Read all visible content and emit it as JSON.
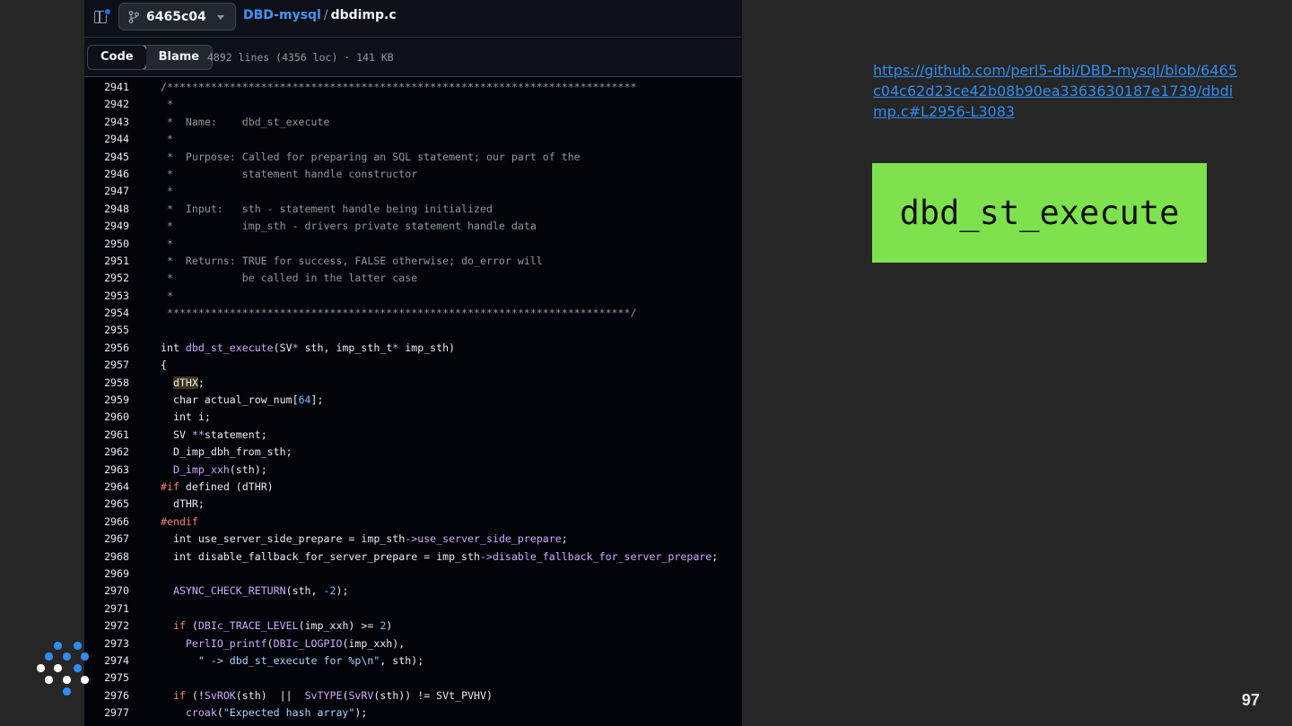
{
  "github": {
    "branch": "6465c04",
    "repo": "DBD-mysql",
    "separator": "/",
    "file": "dbdimp.c",
    "tabs": [
      "Code",
      "Blame"
    ],
    "file_meta": "4892 lines (4356 loc) · 141 KB"
  },
  "code_lines": [
    {
      "n": "2941",
      "t": "/***************************************************************************"
    },
    {
      "n": "2942",
      "t": " *"
    },
    {
      "n": "2943",
      "t": " *  Name:    dbd_st_execute"
    },
    {
      "n": "2944",
      "t": " *"
    },
    {
      "n": "2945",
      "t": " *  Purpose: Called for preparing an SQL statement; our part of the"
    },
    {
      "n": "2946",
      "t": " *           statement handle constructor"
    },
    {
      "n": "2947",
      "t": " *"
    },
    {
      "n": "2948",
      "t": " *  Input:   sth - statement handle being initialized"
    },
    {
      "n": "2949",
      "t": " *           imp_sth - drivers private statement handle data"
    },
    {
      "n": "2950",
      "t": " *"
    },
    {
      "n": "2951",
      "t": " *  Returns: TRUE for success, FALSE otherwise; do_error will"
    },
    {
      "n": "2952",
      "t": " *           be called in the latter case"
    },
    {
      "n": "2953",
      "t": " *"
    },
    {
      "n": "2954",
      "t": " **************************************************************************/"
    },
    {
      "n": "2955",
      "t": ""
    },
    {
      "n": "2956",
      "t": "int dbd_st_execute(SV* sth, imp_sth_t* imp_sth)"
    },
    {
      "n": "2957",
      "t": "{"
    },
    {
      "n": "2958",
      "t": "  dTHX;"
    },
    {
      "n": "2959",
      "t": "  char actual_row_num[64];"
    },
    {
      "n": "2960",
      "t": "  int i;"
    },
    {
      "n": "2961",
      "t": "  SV **statement;"
    },
    {
      "n": "2962",
      "t": "  D_imp_dbh_from_sth;"
    },
    {
      "n": "2963",
      "t": "  D_imp_xxh(sth);"
    },
    {
      "n": "2964",
      "t": "#if defined (dTHR)"
    },
    {
      "n": "2965",
      "t": "  dTHR;"
    },
    {
      "n": "2966",
      "t": "#endif"
    },
    {
      "n": "2967",
      "t": "  int use_server_side_prepare = imp_sth->use_server_side_prepare;"
    },
    {
      "n": "2968",
      "t": "  int disable_fallback_for_server_prepare = imp_sth->disable_fallback_for_server_prepare;"
    },
    {
      "n": "2969",
      "t": ""
    },
    {
      "n": "2970",
      "t": "  ASYNC_CHECK_RETURN(sth, -2);"
    },
    {
      "n": "2971",
      "t": ""
    },
    {
      "n": "2972",
      "t": "  if (DBIc_TRACE_LEVEL(imp_xxh) >= 2)"
    },
    {
      "n": "2973",
      "t": "    PerlIO_printf(DBIc_LOGPIO(imp_xxh),"
    },
    {
      "n": "2974",
      "t": "      \" -> dbd_st_execute for %p\\n\", sth);"
    },
    {
      "n": "2975",
      "t": ""
    },
    {
      "n": "2976",
      "t": "  if (!SvROK(sth)  ||  SvTYPE(SvRV(sth)) != SVt_PVHV)"
    },
    {
      "n": "2977",
      "t": "    croak(\"Expected hash array\");"
    }
  ],
  "slide": {
    "link": "https://github.com/perl5-dbi/DBD-mysql/blob/6465c04c62d23ce42b08b90ea3363630187e1739/dbdimp.c#L2956-L3083",
    "function_name": "dbd_st_execute",
    "page_number": "97"
  },
  "colors": {
    "slide_bg": "#262626",
    "green_box": "#7ee24e",
    "link": "#2f8cf0"
  }
}
